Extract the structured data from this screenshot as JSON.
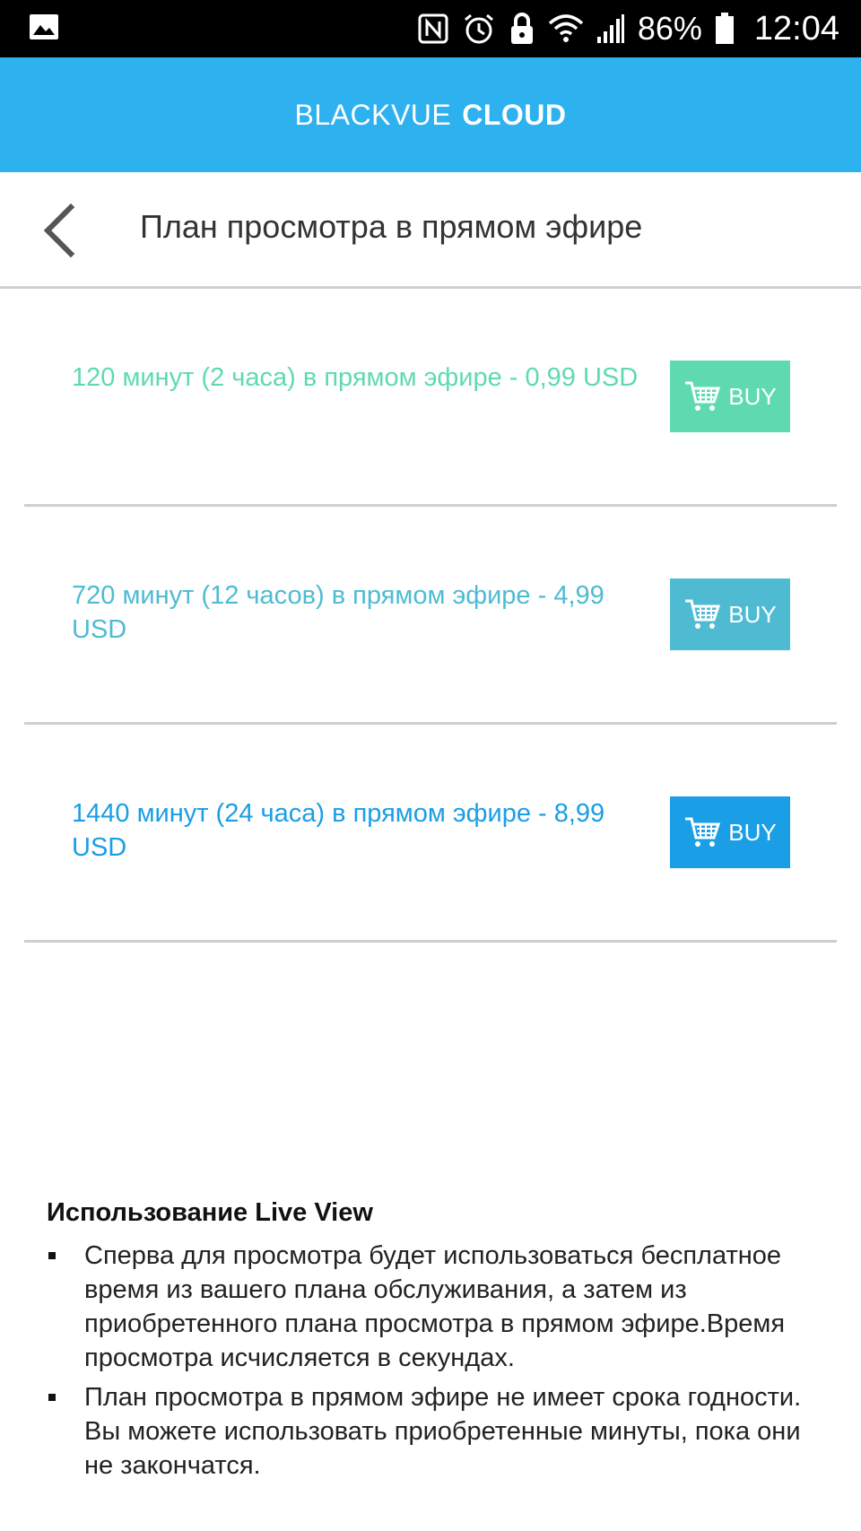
{
  "status_bar": {
    "battery": "86%",
    "time": "12:04"
  },
  "header": {
    "brand_light": "BLACKVUE",
    "brand_bold": "CLOUD"
  },
  "title_bar": {
    "title": "План просмотра в прямом эфире"
  },
  "plans": [
    {
      "label": "120 минут (2 часа) в прямом эфире - 0,99 USD",
      "button": "BUY",
      "color": "#5fdab0"
    },
    {
      "label": "720 минут (12 часов) в прямом эфире - 4,99 USD",
      "button": "BUY",
      "color": "#4fbbd3"
    },
    {
      "label": "1440 минут (24 часа) в прямом эфире - 8,99 USD",
      "button": "BUY",
      "color": "#1a9ee6"
    }
  ],
  "info": {
    "heading": "Использование Live View",
    "items": [
      "Сперва для просмотра будет использоваться бесплатное время из вашего плана обслуживания, а затем из приобретенного плана просмотра в прямом эфире.Время просмотра исчисляется в секундах.",
      "План просмотра в прямом эфире не имеет срока годности. Вы можете использовать приобретенные минуты, пока они не закончатся."
    ]
  }
}
